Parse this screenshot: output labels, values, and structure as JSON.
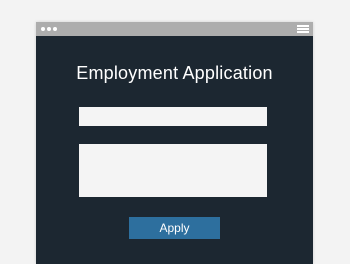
{
  "form": {
    "title": "Employment Application",
    "fields": [
      {
        "value": "",
        "placeholder": ""
      },
      {
        "value": "",
        "placeholder": ""
      }
    ],
    "submit_label": "Apply"
  },
  "colors": {
    "background": "#f3f3f3",
    "window": "#1c2731",
    "titlebar": "#adadad",
    "field": "#f4f4f4",
    "button": "#2d6f9e"
  },
  "icons": [
    "window-dot-icon",
    "menu-icon"
  ]
}
